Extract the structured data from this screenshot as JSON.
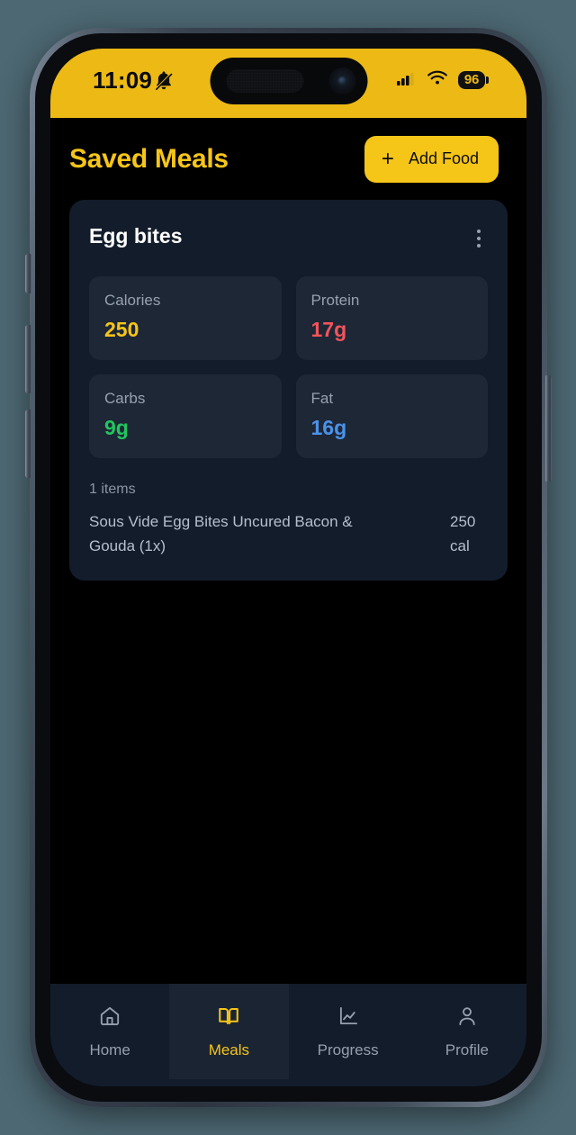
{
  "status_bar": {
    "time": "11:09",
    "silent_icon": "bell-slash-icon",
    "cellular_icon": "cellular-signal-icon",
    "wifi_icon": "wifi-icon",
    "battery_level": "96"
  },
  "header": {
    "title": "Saved Meals",
    "add_button": {
      "label": "Add Food",
      "plus_icon": "plus-icon"
    }
  },
  "meal_card": {
    "name": "Egg bites",
    "menu_icon": "more-vertical-icon",
    "macros": [
      {
        "label": "Calories",
        "value": "250",
        "color": "#f5c518"
      },
      {
        "label": "Protein",
        "value": "17g",
        "color": "#f2545b"
      },
      {
        "label": "Carbs",
        "value": "9g",
        "color": "#22c55e"
      },
      {
        "label": "Fat",
        "value": "16g",
        "color": "#4b92ea"
      }
    ],
    "items_count": "1 items",
    "items": [
      {
        "name": "Sous Vide Egg Bites Uncured Bacon & Gouda (1x)",
        "calories": "250 cal"
      }
    ]
  },
  "tabbar": {
    "tabs": [
      {
        "label": "Home",
        "icon": "home-icon",
        "active": false
      },
      {
        "label": "Meals",
        "icon": "book-icon",
        "active": true
      },
      {
        "label": "Progress",
        "icon": "chart-line-icon",
        "active": false
      },
      {
        "label": "Profile",
        "icon": "person-icon",
        "active": false
      }
    ]
  },
  "theme": {
    "accent": "#f5c518",
    "status_bar_bg": "#edba15",
    "app_bg": "#000000",
    "card_bg": "#131c2b",
    "tile_bg": "#1e2736"
  }
}
